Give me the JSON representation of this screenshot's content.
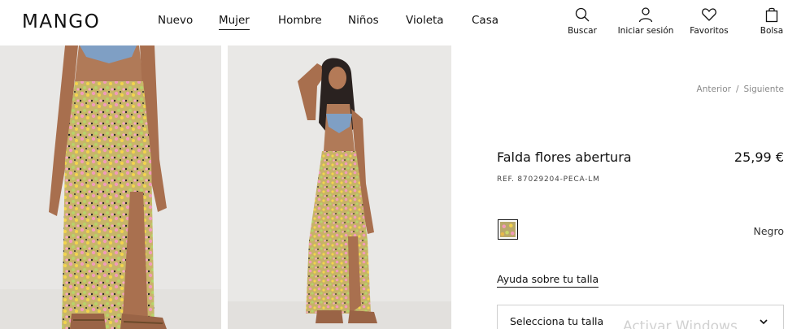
{
  "brand": {
    "logo_text": "MANGO"
  },
  "nav": {
    "items": [
      {
        "label": "Nuevo"
      },
      {
        "label": "Mujer",
        "active": true
      },
      {
        "label": "Hombre"
      },
      {
        "label": "Niños"
      },
      {
        "label": "Violeta"
      },
      {
        "label": "Casa"
      }
    ]
  },
  "toolbar": {
    "search": {
      "label": "Buscar",
      "icon": "search-icon"
    },
    "login": {
      "label": "Iniciar sesión",
      "icon": "user-icon"
    },
    "favorites": {
      "label": "Favoritos",
      "icon": "heart-icon"
    },
    "bag": {
      "label": "Bolsa",
      "icon": "bag-icon"
    }
  },
  "pager": {
    "prev": "Anterior",
    "separator": "/",
    "next": "Siguiente"
  },
  "product": {
    "name": "Falda flores abertura",
    "price": "25,99 €",
    "reference": "REF. 87029204-PECA-LM",
    "color": {
      "name": "Negro",
      "swatch": "floral-print"
    },
    "size_help": "Ayuda sobre tu talla",
    "size_select": {
      "placeholder": "Selecciona tu talla"
    }
  },
  "overlay": {
    "watermark": "Activar Windows"
  },
  "colors": {
    "text": "#111111",
    "muted": "#8a8a8a",
    "photo_bg": "#e9e8e6",
    "border": "#cfcfcf"
  }
}
